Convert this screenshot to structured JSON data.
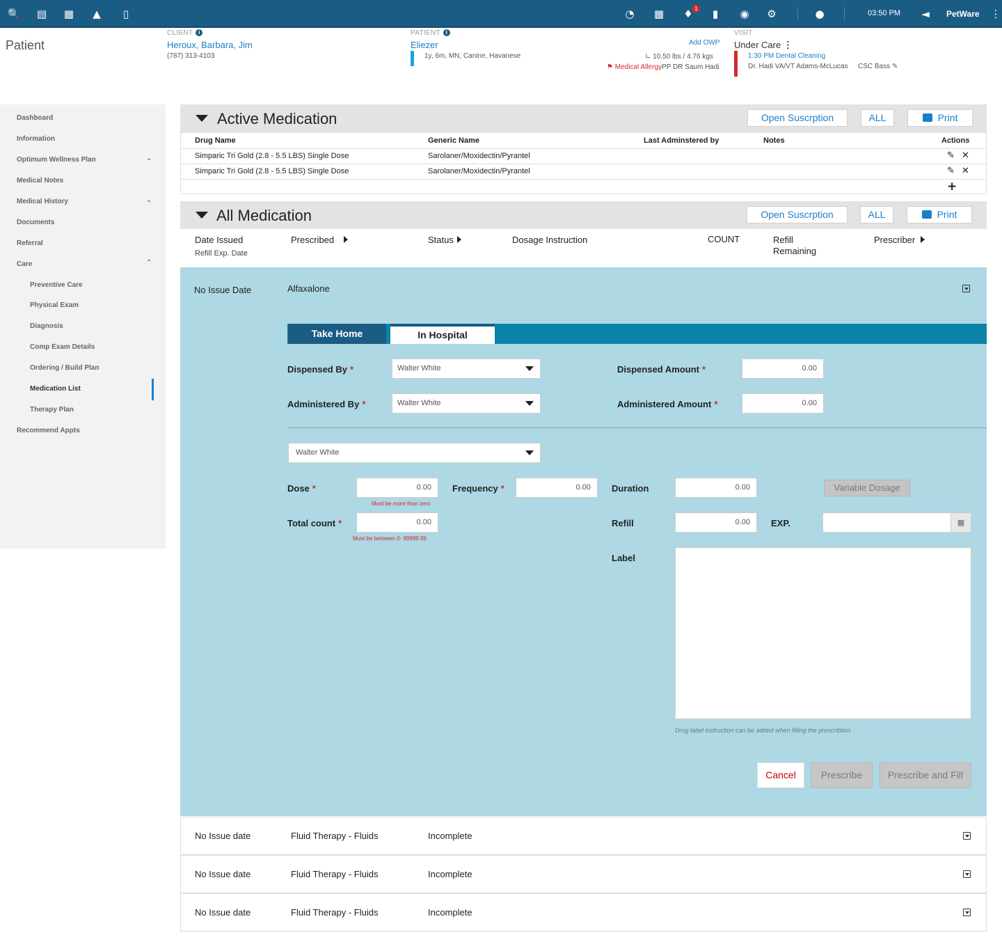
{
  "topbar": {
    "icons": [
      "search-icon",
      "gift-icon",
      "calendar-icon",
      "flask-icon",
      "mobile-icon",
      "dashboard-icon",
      "list-icon",
      "bell-icon",
      "document-icon",
      "globe-icon",
      "gear-icon",
      "users-icon",
      "megaphone-icon",
      "more-icon"
    ],
    "notification_count": "1",
    "time": "03:50 PM",
    "brand": "PetWare",
    "colors": {
      "primary": "#1b5c85",
      "accent": "#1a7fc9",
      "alert": "#d42a2a",
      "panel": "#add8e4",
      "tab_strip": "#0b83a8"
    }
  },
  "header": {
    "page_title": "Patient",
    "client": {
      "label": "CLIENT",
      "name": "Heroux, Barbara, Jim",
      "phone": "(787) 313-4103"
    },
    "patient": {
      "label": "PATIENT",
      "name": "Eliezer",
      "details": "1y, 6m, MN, Canine, Havanese"
    },
    "add_owp": "Add OWP",
    "weight": "10.50 lbs / 4.76 kgs",
    "allergy": "Medical Allergy",
    "allergy_doctor": "PP DR Saum Hadi",
    "visit": {
      "label": "VISIT",
      "status": "Under Care",
      "appointment": "1:30 PM Dental Cleaning",
      "doctors": "Dr. Hadi VA/VT Adams-McLucas",
      "csc": "CSC Bass"
    }
  },
  "sidebar": {
    "items": [
      {
        "label": "Dashboard"
      },
      {
        "label": "Information"
      },
      {
        "label": "Optimum Wellness Plan"
      },
      {
        "label": "Medical Notes"
      },
      {
        "label": "Medical History"
      },
      {
        "label": "Documents"
      },
      {
        "label": "Referral"
      },
      {
        "label": "Care"
      },
      {
        "label": "Preventive Care"
      },
      {
        "label": "Physical Exam"
      },
      {
        "label": "Diagnosis"
      },
      {
        "label": "Comp Exam Details"
      },
      {
        "label": "Ordering / Build Plan"
      },
      {
        "label": "Medication List"
      },
      {
        "label": "Therapy Plan"
      },
      {
        "label": "Recommend Appts"
      }
    ]
  },
  "active_medication": {
    "title": "Active Medication",
    "btn_subscription": "Open Suscrption",
    "btn_all": "ALL",
    "btn_print": "Print",
    "columns": [
      "Drug Name",
      "Generic Name",
      "Last Adminstered by",
      "Notes",
      "Actions"
    ],
    "rows": [
      {
        "drug": "Simparic Tri Gold (2.8 - 5.5 LBS) Single Dose",
        "generic": "Sarolaner/Moxidectin/Pyrantel"
      },
      {
        "drug": "Simparic Tri Gold (2.8 - 5.5 LBS) Single Dose",
        "generic": "Sarolaner/Moxidectin/Pyrantel"
      }
    ]
  },
  "all_medication": {
    "title": "All Medication",
    "btn_subscription": "Open Suscrption",
    "btn_all": "ALL",
    "btn_print": "Print",
    "columns": {
      "date_issued": "Date Issued",
      "refill_exp": "Refill Exp. Date",
      "prescribed": "Prescribed",
      "status": "Status",
      "dosage": "Dosage Instruction",
      "count": "COUNT",
      "refill_remaining": "Refill Remaining",
      "prescriber": "Prescriber"
    }
  },
  "expanded": {
    "date": "No Issue Date",
    "drug": "Alfaxalone",
    "tab_take_home": "Take Home",
    "tab_in_hospital": "In Hospital",
    "dispensed_by_label": "Dispensed By",
    "dispensed_by_value": "Walter White",
    "dispensed_amount_label": "Dispensed Amount",
    "dispensed_amount_value": "0.00",
    "administered_by_label": "Administered By",
    "administered_by_value": "Walter White",
    "administered_amount_label": "Administered Amount",
    "administered_amount_value": "0.00",
    "prescriber_value": "Walter White",
    "dose_label": "Dose",
    "dose_value": "0.00",
    "dose_error": "Must be more than zero",
    "frequency_label": "Frequency",
    "frequency_value": "0.00",
    "duration_label": "Duration",
    "duration_value": "0.00",
    "variable_dosage": "Variable Dosage",
    "total_count_label": "Total count",
    "total_count_value": "0.00",
    "total_count_error": "Must be  between  0- 99999.99",
    "refill_label": "Refill",
    "refill_value": "0.00",
    "exp_label": "EXP.",
    "label_label": "Label",
    "label_hint": "Drug label  instruction can be added when filling the prescribtion",
    "btn_cancel": "Cancel",
    "btn_prescribe": "Prescribe",
    "btn_prescribe_fill": "Prescribe and Fill"
  },
  "med_rows": [
    {
      "date": "No Issue date",
      "drug": "Fluid Therapy - Fluids",
      "status": "Incomplete"
    },
    {
      "date": "No Issue date",
      "drug": "Fluid Therapy - Fluids",
      "status": "Incomplete"
    },
    {
      "date": "No Issue date",
      "drug": "Fluid Therapy - Fluids",
      "status": "Incomplete"
    }
  ]
}
